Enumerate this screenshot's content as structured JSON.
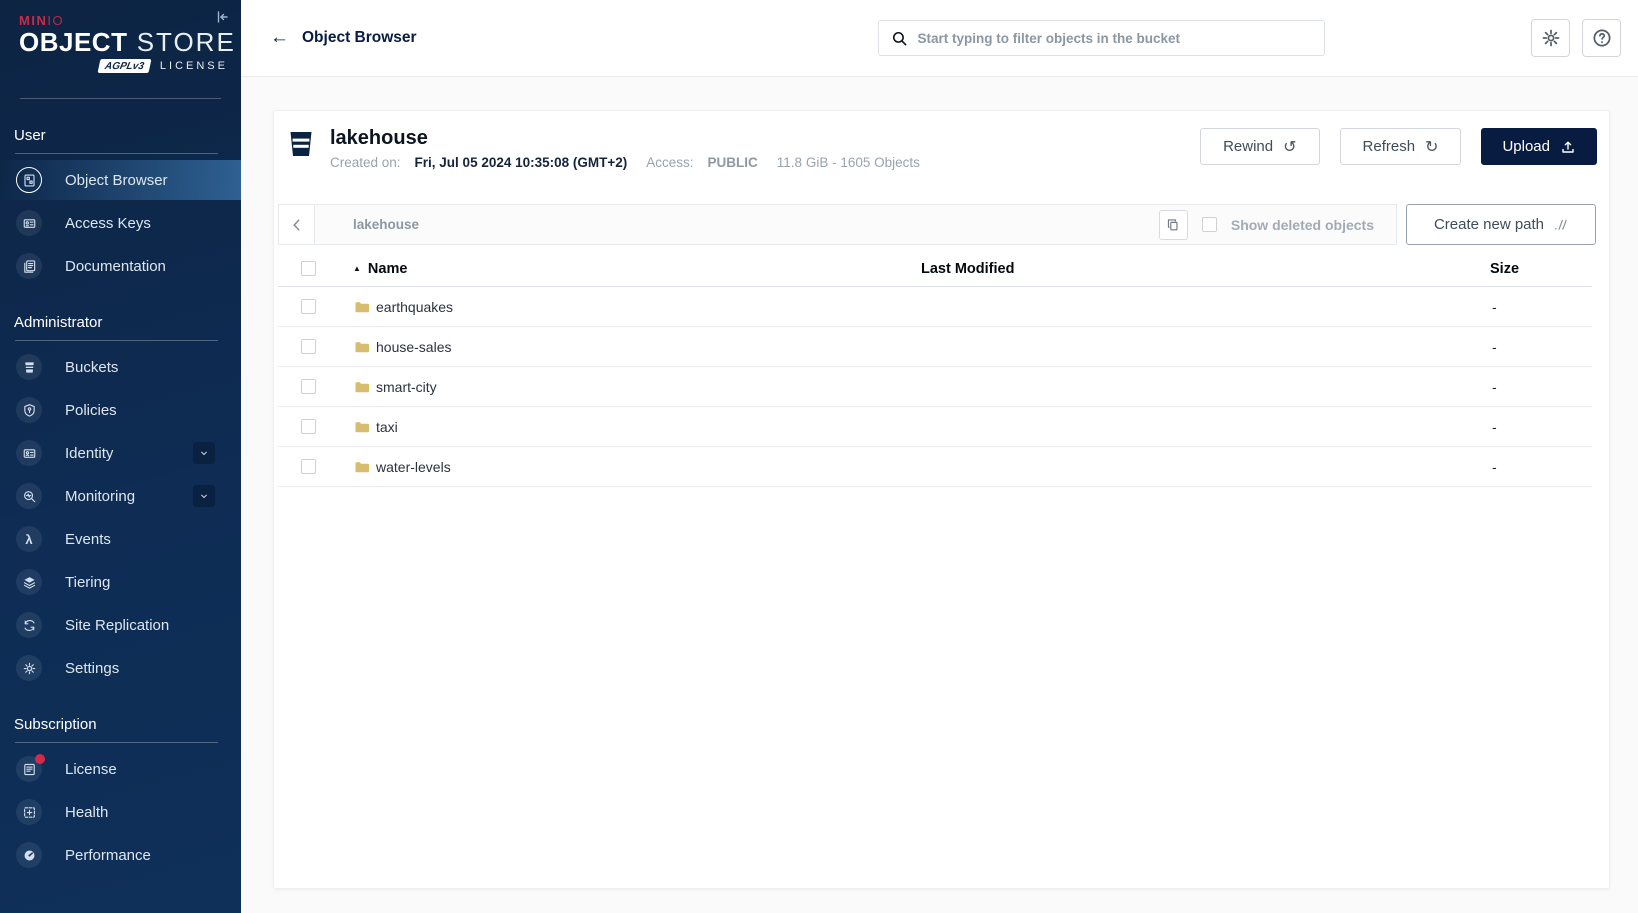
{
  "colors": {
    "brand_red": "#c72c49",
    "navy": "#081c42",
    "sidebar_top": "#0d2443",
    "sidebar_bottom": "#0f3059",
    "active_item_gradient_end": "#2e6091",
    "folder_icon": "#d9bd6e",
    "license_alert_dot": "#d5294b"
  },
  "logo": {
    "brand_bold": "MIN",
    "brand_thin": "IO",
    "product_bold": "OBJECT",
    "product_thin": " STORE",
    "badge": "AGPLv3",
    "license_word": "LICENSE"
  },
  "sidebar": {
    "sections": [
      {
        "label": "User",
        "items": [
          {
            "label": "Object Browser"
          },
          {
            "label": "Access Keys"
          },
          {
            "label": "Documentation"
          }
        ]
      },
      {
        "label": "Administrator",
        "items": [
          {
            "label": "Buckets"
          },
          {
            "label": "Policies"
          },
          {
            "label": "Identity"
          },
          {
            "label": "Monitoring"
          },
          {
            "label": "Events"
          },
          {
            "label": "Tiering"
          },
          {
            "label": "Site Replication"
          },
          {
            "label": "Settings"
          }
        ]
      },
      {
        "label": "Subscription",
        "items": [
          {
            "label": "License"
          },
          {
            "label": "Health"
          },
          {
            "label": "Performance"
          }
        ]
      }
    ]
  },
  "topbar": {
    "back_icon": "←",
    "title": "Object Browser",
    "search_placeholder": "Start typing to filter objects in the bucket"
  },
  "bucket": {
    "name": "lakehouse",
    "created_label": "Created on:",
    "created_value": "Fri, Jul 05 2024 10:35:08 (GMT+2)",
    "access_label": "Access:",
    "access_value": "PUBLIC",
    "stats": "11.8 GiB - 1605 Objects",
    "rewind_label": "Rewind",
    "rewind_icon": "↺",
    "refresh_label": "Refresh",
    "refresh_icon": "↻",
    "upload_label": "Upload"
  },
  "pathbar": {
    "path": "lakehouse",
    "show_deleted_label": "Show deleted objects",
    "create_path_label": "Create new path"
  },
  "table": {
    "sort_icon": "▲",
    "columns": {
      "name": "Name",
      "modified": "Last Modified",
      "size": "Size"
    },
    "rows": [
      {
        "name": "earthquakes",
        "modified": "",
        "size": "-"
      },
      {
        "name": "house-sales",
        "modified": "",
        "size": "-"
      },
      {
        "name": "smart-city",
        "modified": "",
        "size": "-"
      },
      {
        "name": "taxi",
        "modified": "",
        "size": "-"
      },
      {
        "name": "water-levels",
        "modified": "",
        "size": "-"
      }
    ]
  }
}
